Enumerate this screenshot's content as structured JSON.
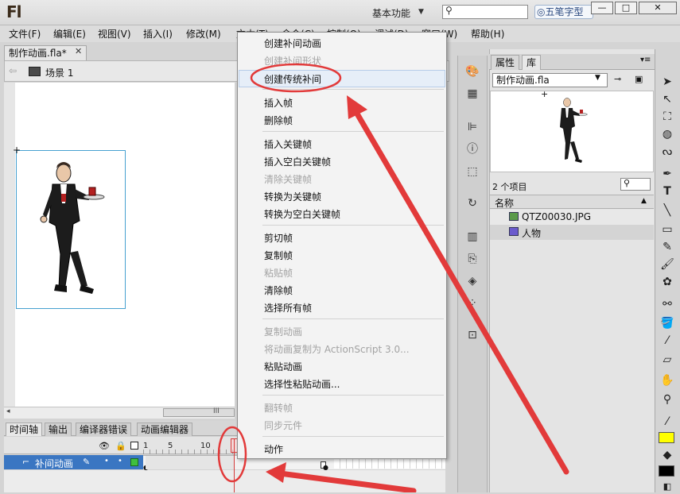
{
  "app": {
    "logo": "Fl",
    "workspace": "基本功能",
    "ime_badge": "五笔字型",
    "window_buttons": [
      "—",
      "□",
      "✕"
    ]
  },
  "menubar": [
    "文件(F)",
    "编辑(E)",
    "视图(V)",
    "插入(I)",
    "修改(M)",
    "文本(T)",
    "命令(C)",
    "控制(O)",
    "调试(D)",
    "窗口(W)",
    "帮助(H)"
  ],
  "document": {
    "tab_label": "制作动画.fla*",
    "scene_label": "场景 1"
  },
  "context_menu": {
    "items": [
      {
        "label": "创建补间动画",
        "disabled": false
      },
      {
        "label": "创建补间形状",
        "disabled": true
      },
      {
        "label": "创建传统补间",
        "disabled": false
      },
      {
        "label": "插入帧",
        "disabled": false
      },
      {
        "label": "删除帧",
        "disabled": false
      },
      {
        "label": "插入关键帧",
        "disabled": false
      },
      {
        "label": "插入空白关键帧",
        "disabled": false
      },
      {
        "label": "清除关键帧",
        "disabled": true
      },
      {
        "label": "转换为关键帧",
        "disabled": false
      },
      {
        "label": "转换为空白关键帧",
        "disabled": false
      },
      {
        "label": "剪切帧",
        "disabled": false
      },
      {
        "label": "复制帧",
        "disabled": false
      },
      {
        "label": "粘贴帧",
        "disabled": true
      },
      {
        "label": "清除帧",
        "disabled": false
      },
      {
        "label": "选择所有帧",
        "disabled": false
      },
      {
        "label": "复制动画",
        "disabled": true
      },
      {
        "label": "将动画复制为 ActionScript 3.0...",
        "disabled": true
      },
      {
        "label": "粘贴动画",
        "disabled": false
      },
      {
        "label": "选择性粘贴动画...",
        "disabled": false
      },
      {
        "label": "翻转帧",
        "disabled": true
      },
      {
        "label": "同步元件",
        "disabled": true
      },
      {
        "label": "动作",
        "disabled": false
      }
    ]
  },
  "timeline": {
    "tabs": [
      "时间轴",
      "输出",
      "编译器错误",
      "动画编辑器"
    ],
    "ticks": [
      "1",
      "5",
      "10"
    ],
    "layer_name": "补间动画"
  },
  "library": {
    "tabs": [
      "属性",
      "库"
    ],
    "document_select": "制作动画.fla",
    "item_count": "2 个项目",
    "column_name": "名称",
    "items": [
      "QTZ00030.JPG",
      "人物"
    ]
  },
  "colors": {
    "annotation": "#e23a3a",
    "layer_selected": "#3a76c2",
    "stage_selection": "#46a0d0"
  }
}
